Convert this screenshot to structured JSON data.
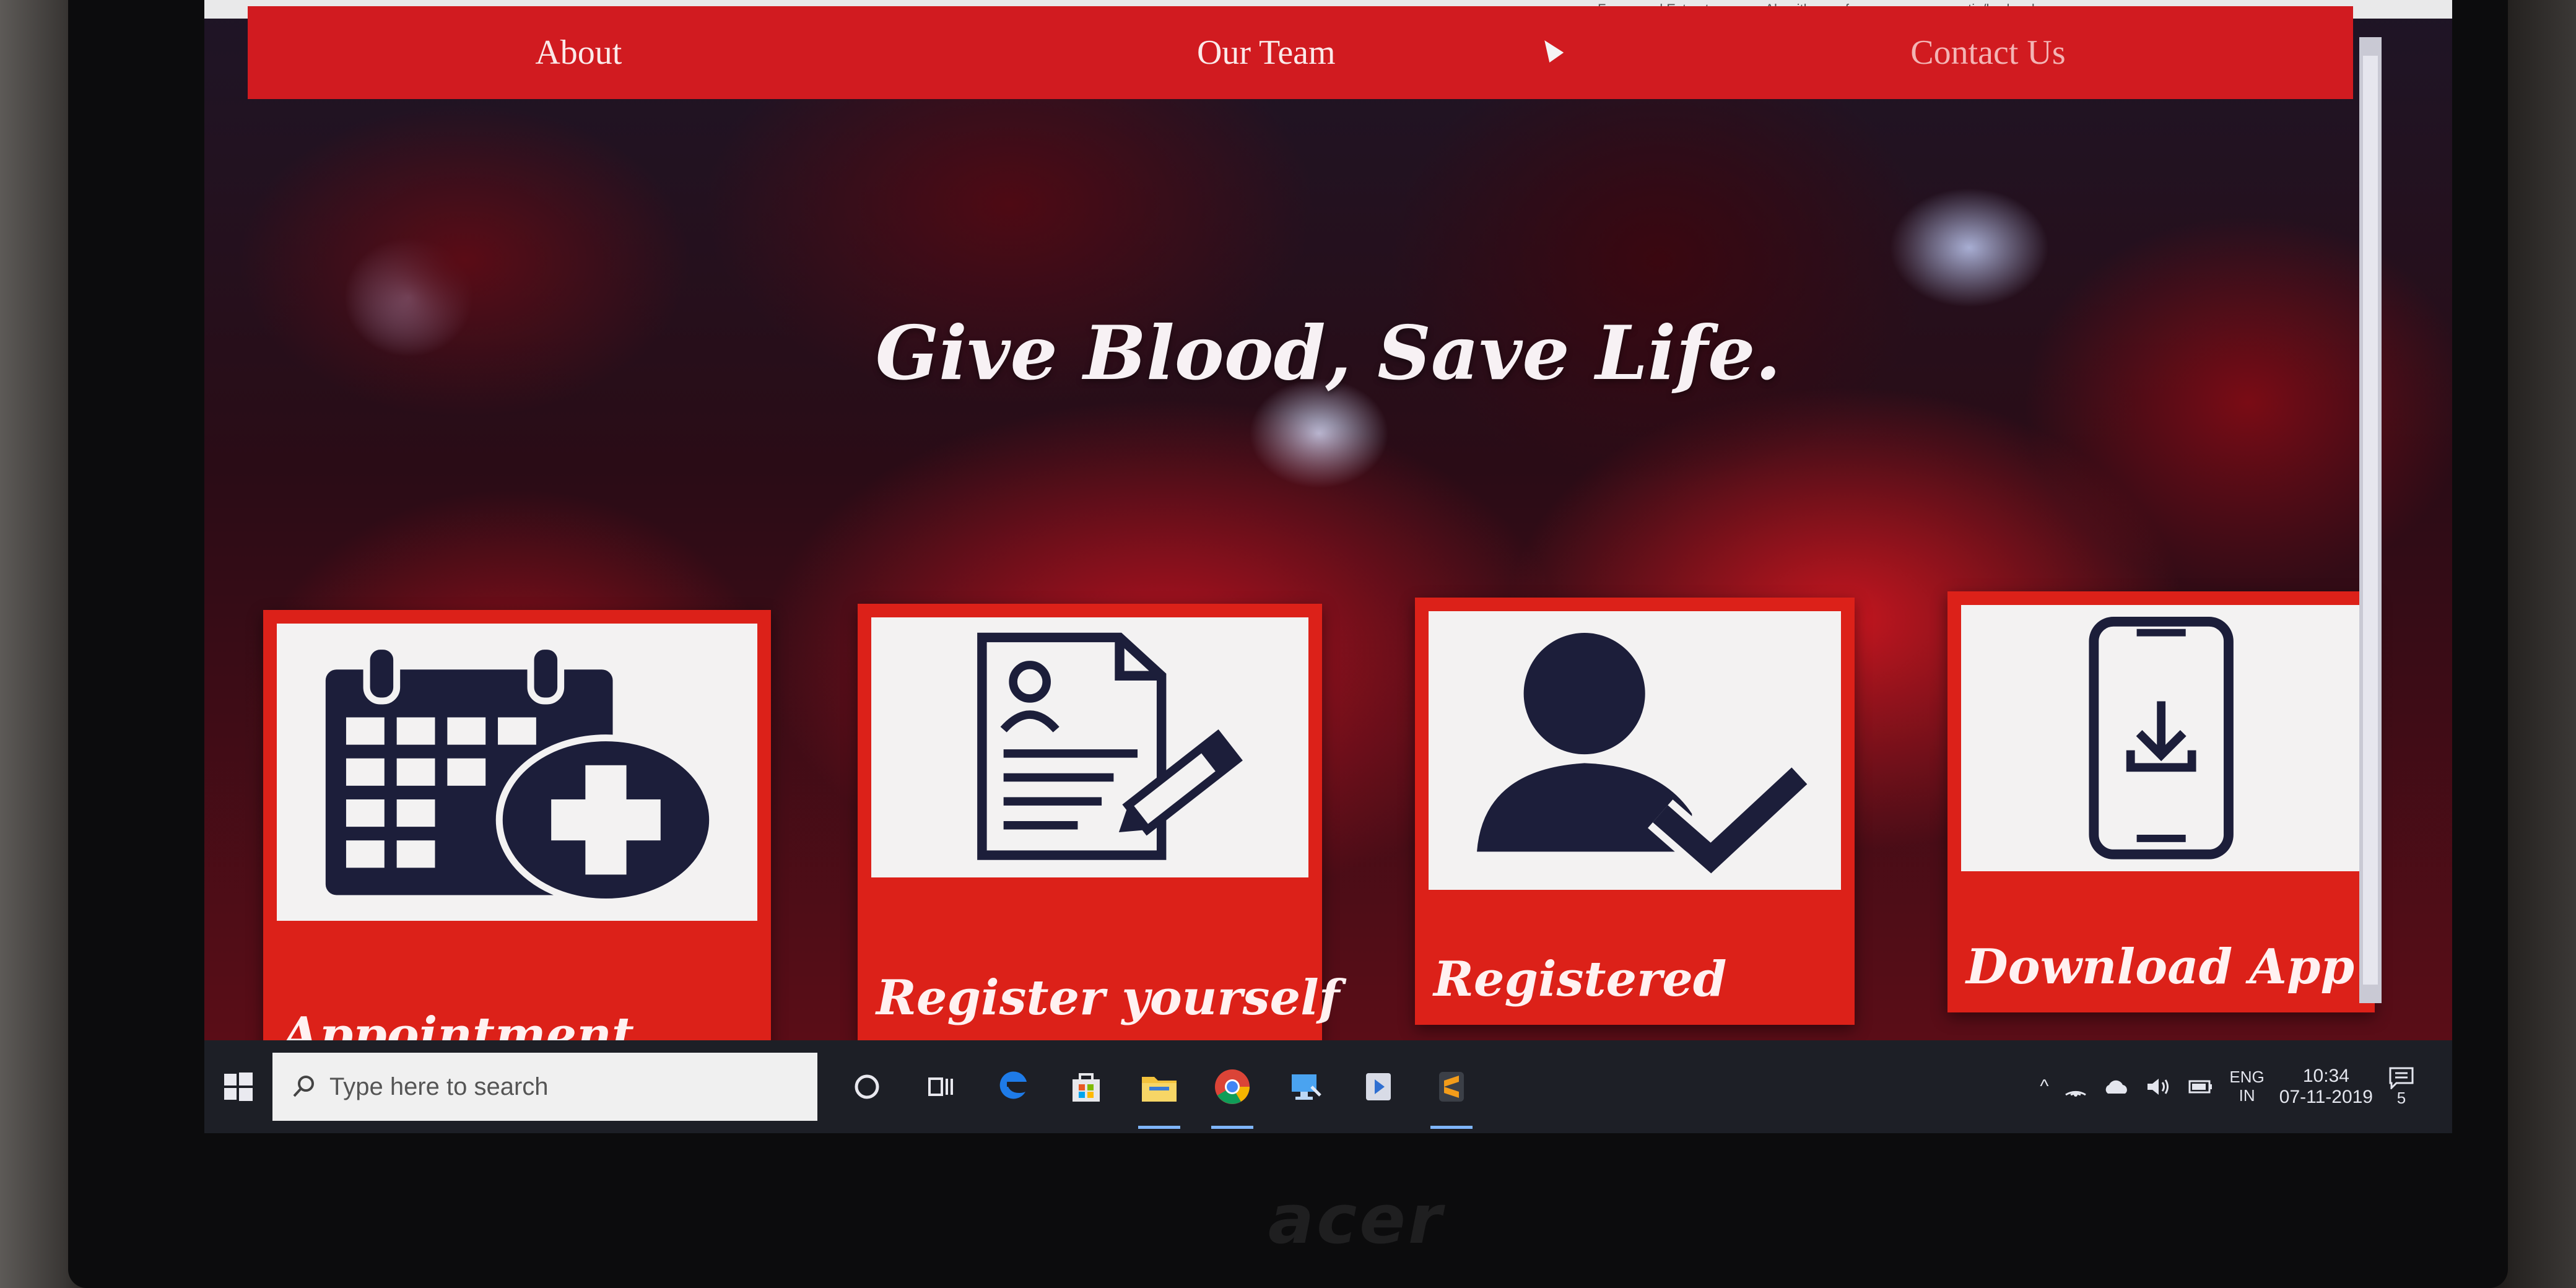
{
  "browser": {
    "bookmarks": [
      "Freesound Extracto...",
      "Algorithms referenc...",
      "essentia/lowlevelsp...",
      "»"
    ]
  },
  "nav": {
    "items": [
      {
        "label": "About"
      },
      {
        "label": "Our Team"
      },
      {
        "label": "Contact Us"
      }
    ]
  },
  "hero": {
    "tagline": "Give Blood, Save Life."
  },
  "cards": [
    {
      "label": "Appointment",
      "icon": "calendar-plus-icon"
    },
    {
      "label": "Register yourself",
      "icon": "form-edit-icon"
    },
    {
      "label": "Registered",
      "icon": "user-check-icon"
    },
    {
      "label": "Download App",
      "icon": "phone-download-icon"
    }
  ],
  "taskbar": {
    "search_placeholder": "Type here to search",
    "language": "ENG",
    "region": "IN",
    "time": "10:34",
    "date": "07-11-2019",
    "notification_count": "5"
  },
  "colors": {
    "accent": "#d11b20",
    "card": "#dc2119",
    "card_image_bg": "#f3f2f2",
    "icon": "#1c1e3a"
  }
}
